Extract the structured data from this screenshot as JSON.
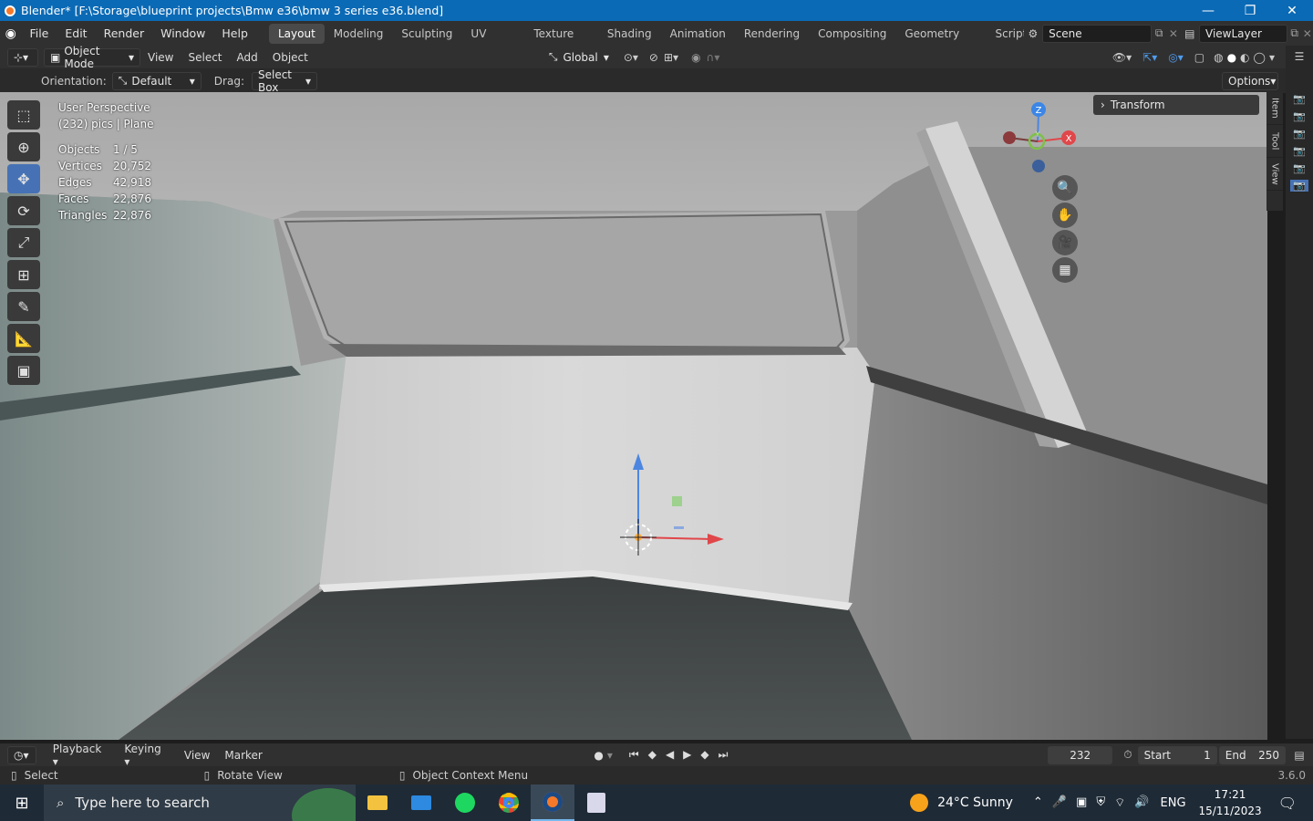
{
  "window": {
    "title": "Blender* [F:\\Storage\\blueprint projects\\Bmw e36\\bmw 3 series e36.blend]"
  },
  "menu": {
    "file": "File",
    "edit": "Edit",
    "render": "Render",
    "window": "Window",
    "help": "Help"
  },
  "workspaces": [
    "Layout",
    "Modeling",
    "Sculpting",
    "UV Editing",
    "Texture Paint",
    "Shading",
    "Animation",
    "Rendering",
    "Compositing",
    "Geometry Nodes",
    "Scripting"
  ],
  "scene": {
    "name": "Scene",
    "view_layer": "ViewLayer"
  },
  "header": {
    "mode": "Object Mode",
    "view": "View",
    "select": "Select",
    "add": "Add",
    "object": "Object",
    "transform_orientation": "Global"
  },
  "tool_header": {
    "orientation_label": "Orientation:",
    "orientation_value": "Default",
    "drag_label": "Drag:",
    "drag_value": "Select Box",
    "options": "Options"
  },
  "viewport": {
    "perspective": "User Perspective",
    "object_info": "(232) pics | Plane",
    "stats": [
      {
        "k": "Objects",
        "v": "1 / 5"
      },
      {
        "k": "Vertices",
        "v": "20,752"
      },
      {
        "k": "Edges",
        "v": "42,918"
      },
      {
        "k": "Faces",
        "v": "22,876"
      },
      {
        "k": "Triangles",
        "v": "22,876"
      }
    ],
    "transform_panel": "Transform",
    "side_tabs": [
      "Item",
      "Tool",
      "View"
    ],
    "axes": {
      "z": "Z",
      "y": "Y",
      "x": "X"
    }
  },
  "timeline": {
    "playback": "Playback",
    "keying": "Keying",
    "view": "View",
    "marker": "Marker",
    "current_frame": "232",
    "start_label": "Start",
    "start": "1",
    "end_label": "End",
    "end": "250"
  },
  "status": {
    "select": "Select",
    "rotate": "Rotate View",
    "context": "Object Context Menu",
    "version": "3.6.0"
  },
  "taskbar": {
    "search_placeholder": "Type here to search",
    "weather": "24°C  Sunny",
    "lang": "ENG",
    "time": "17:21",
    "date": "15/11/2023"
  }
}
